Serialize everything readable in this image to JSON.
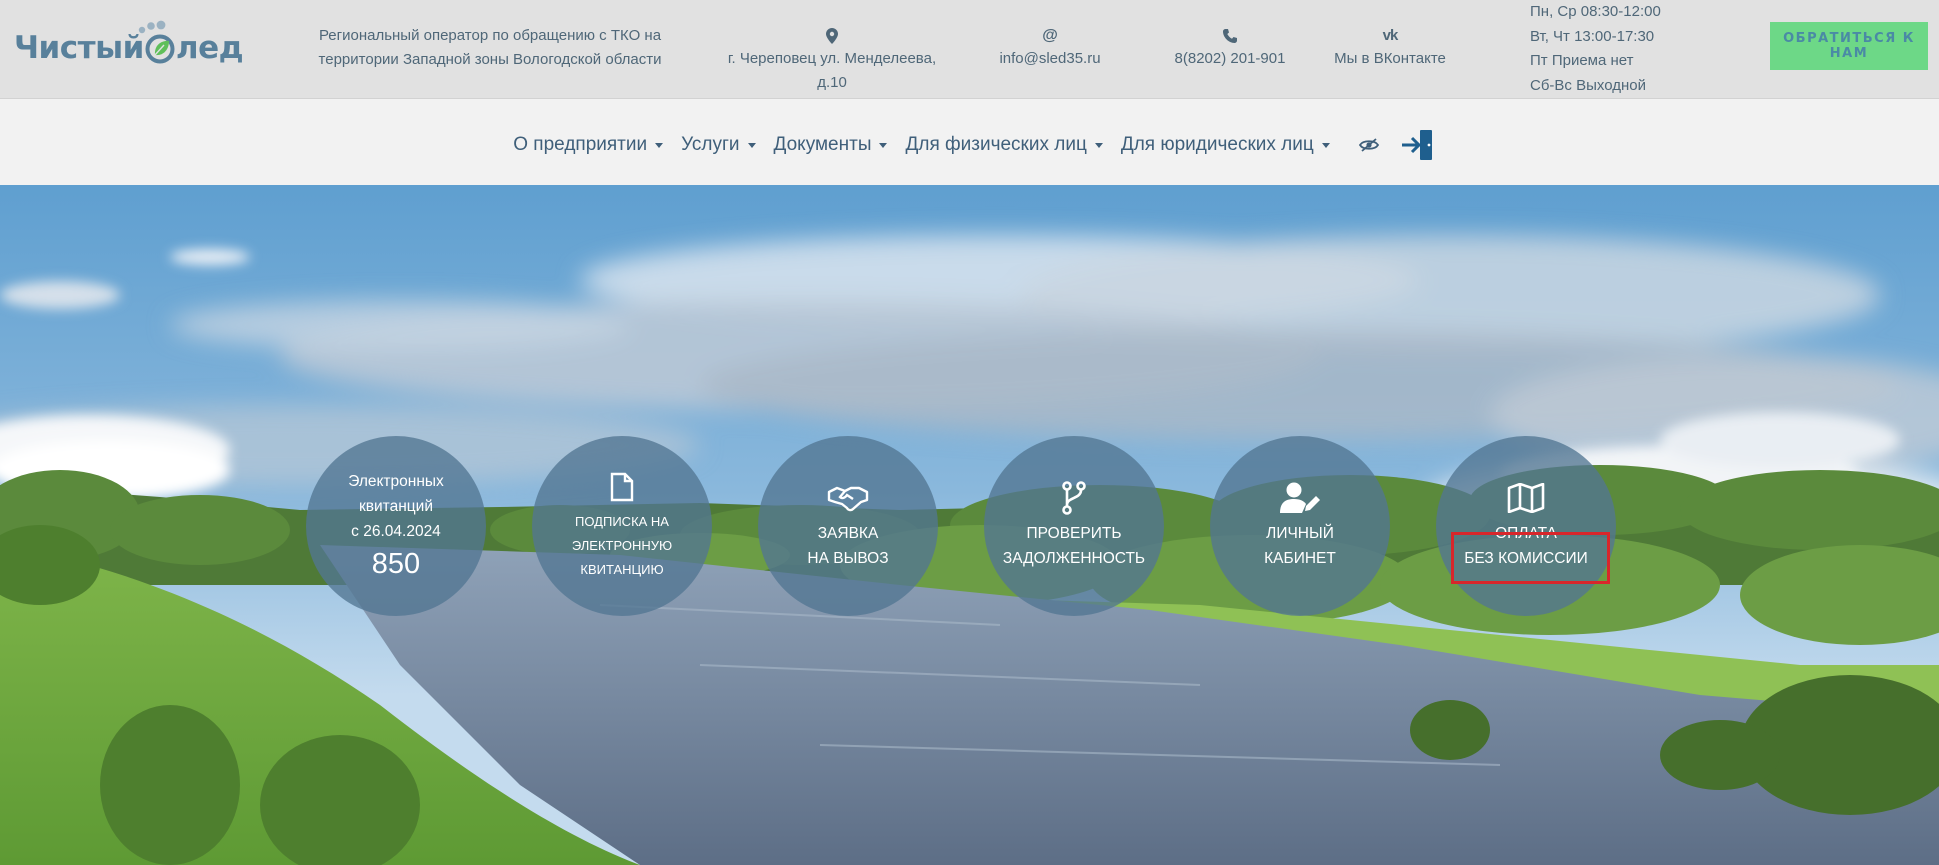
{
  "logo": {
    "text_a": "Чистый",
    "text_b": "лед"
  },
  "header": {
    "operator_line1": "Региональный оператор по обращению с ТКО на",
    "operator_line2": "территории Западной зоны Вологодской области",
    "address": "г. Череповец ул. Менделеева, д.10",
    "email_icon": "@",
    "email": "info@sled35.ru",
    "phone": "8(8202) 201-901",
    "vk_icon": "vk",
    "vk": "Мы в ВКонтакте",
    "hours": [
      "Пн, Ср 08:30-12:00",
      "Вт, Чт 13:00-17:30",
      "Пт Приема нет",
      "Сб-Вс Выходной"
    ],
    "cta": "ОБРАТИТЬСЯ К НАМ"
  },
  "nav": {
    "items": [
      "О предприятии",
      "Услуги",
      "Документы",
      "Для физических лиц",
      "Для юридических лиц"
    ],
    "icons": [
      "eye-icon",
      "login-door-icon"
    ]
  },
  "hero": {
    "circles": [
      {
        "lines": [
          "Электронных",
          "квитанций",
          "с 26.04.2024"
        ],
        "number": "850"
      },
      {
        "icon": "document-icon",
        "lines": [
          "ПОДПИСКА НА",
          "ЭЛЕКТРОННУЮ",
          "КВИТАНЦИЮ"
        ]
      },
      {
        "icon": "handshake-icon",
        "lines": [
          "ЗАЯВКА",
          "НА ВЫВОЗ"
        ]
      },
      {
        "icon": "branch-icon",
        "lines": [
          "ПРОВЕРИТЬ",
          "ЗАДОЛЖЕННОСТЬ"
        ]
      },
      {
        "icon": "user-edit-icon",
        "lines": [
          "ЛИЧНЫЙ",
          "КАБИНЕТ"
        ]
      },
      {
        "icon": "map-icon",
        "lines": [
          "ОПЛАТА",
          "БЕЗ КОМИССИИ"
        ]
      }
    ]
  },
  "colors": {
    "topbar": "#e1e1e1",
    "navbar": "#f2f2f2",
    "text": "#4f6778",
    "cta_bg": "#6dd887",
    "circle_bg": "#527692",
    "highlight": "#d8262b"
  }
}
